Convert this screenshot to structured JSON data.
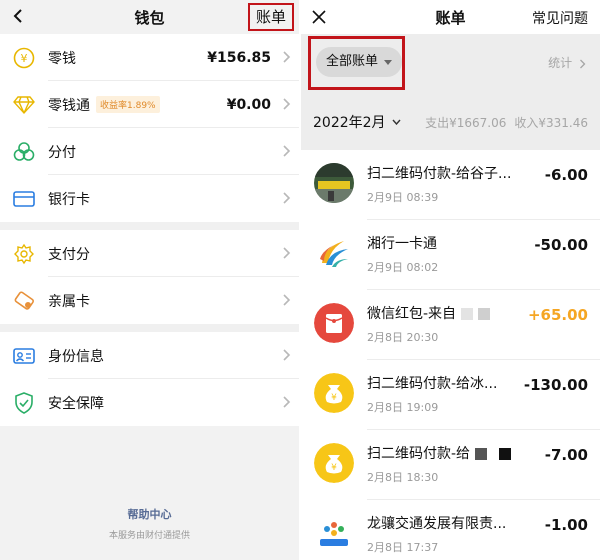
{
  "left": {
    "title": "钱包",
    "bill_link": "账单",
    "items": [
      {
        "label": "零钱",
        "value": "¥156.85",
        "icon": "yuan-coin-icon"
      },
      {
        "label": "零钱通",
        "badge": "收益率1.89%",
        "value": "¥0.00",
        "icon": "diamond-icon"
      },
      {
        "label": "分付",
        "icon": "clover-icon"
      },
      {
        "label": "银行卡",
        "icon": "bank-card-icon"
      }
    ],
    "items2": [
      {
        "label": "支付分",
        "icon": "score-icon"
      },
      {
        "label": "亲属卡",
        "icon": "family-card-icon"
      }
    ],
    "items3": [
      {
        "label": "身份信息",
        "icon": "id-card-icon"
      },
      {
        "label": "安全保障",
        "icon": "shield-icon"
      }
    ],
    "help": "帮助中心",
    "provider": "本服务由财付通提供"
  },
  "right": {
    "title": "账单",
    "faq": "常见问题",
    "filter": "全部账单",
    "stats": "统计",
    "month": "2022年2月",
    "spend": "支出¥1667.06",
    "income": "收入¥331.46",
    "transactions": [
      {
        "name": "扫二维码付款-给谷子...",
        "date": "2月9日 08:39",
        "amount": "-6.00",
        "avatar": "photo-avatar"
      },
      {
        "name": "湘行一卡通",
        "date": "2月9日 08:02",
        "amount": "-50.00",
        "avatar": "transit-logo-avatar"
      },
      {
        "name": "微信红包-来自",
        "date": "2月8日 20:30",
        "amount": "+65.00",
        "avatar": "red-packet-avatar"
      },
      {
        "name": "扫二维码付款-给冰...",
        "date": "2月8日 19:09",
        "amount": "-130.00",
        "avatar": "money-bag-avatar"
      },
      {
        "name": "扫二维码付款-给",
        "date": "2月8日 18:30",
        "amount": "-7.00",
        "avatar": "money-bag-avatar"
      },
      {
        "name": "龙骧交通发展有限责...",
        "date": "2月8日 17:37",
        "amount": "-1.00",
        "avatar": "longxiang-logo-avatar"
      }
    ]
  },
  "colors": {
    "accent_green": "#07c160",
    "highlight_red": "#c2141a",
    "income_orange": "#f5a623",
    "link_blue": "#576b95"
  }
}
